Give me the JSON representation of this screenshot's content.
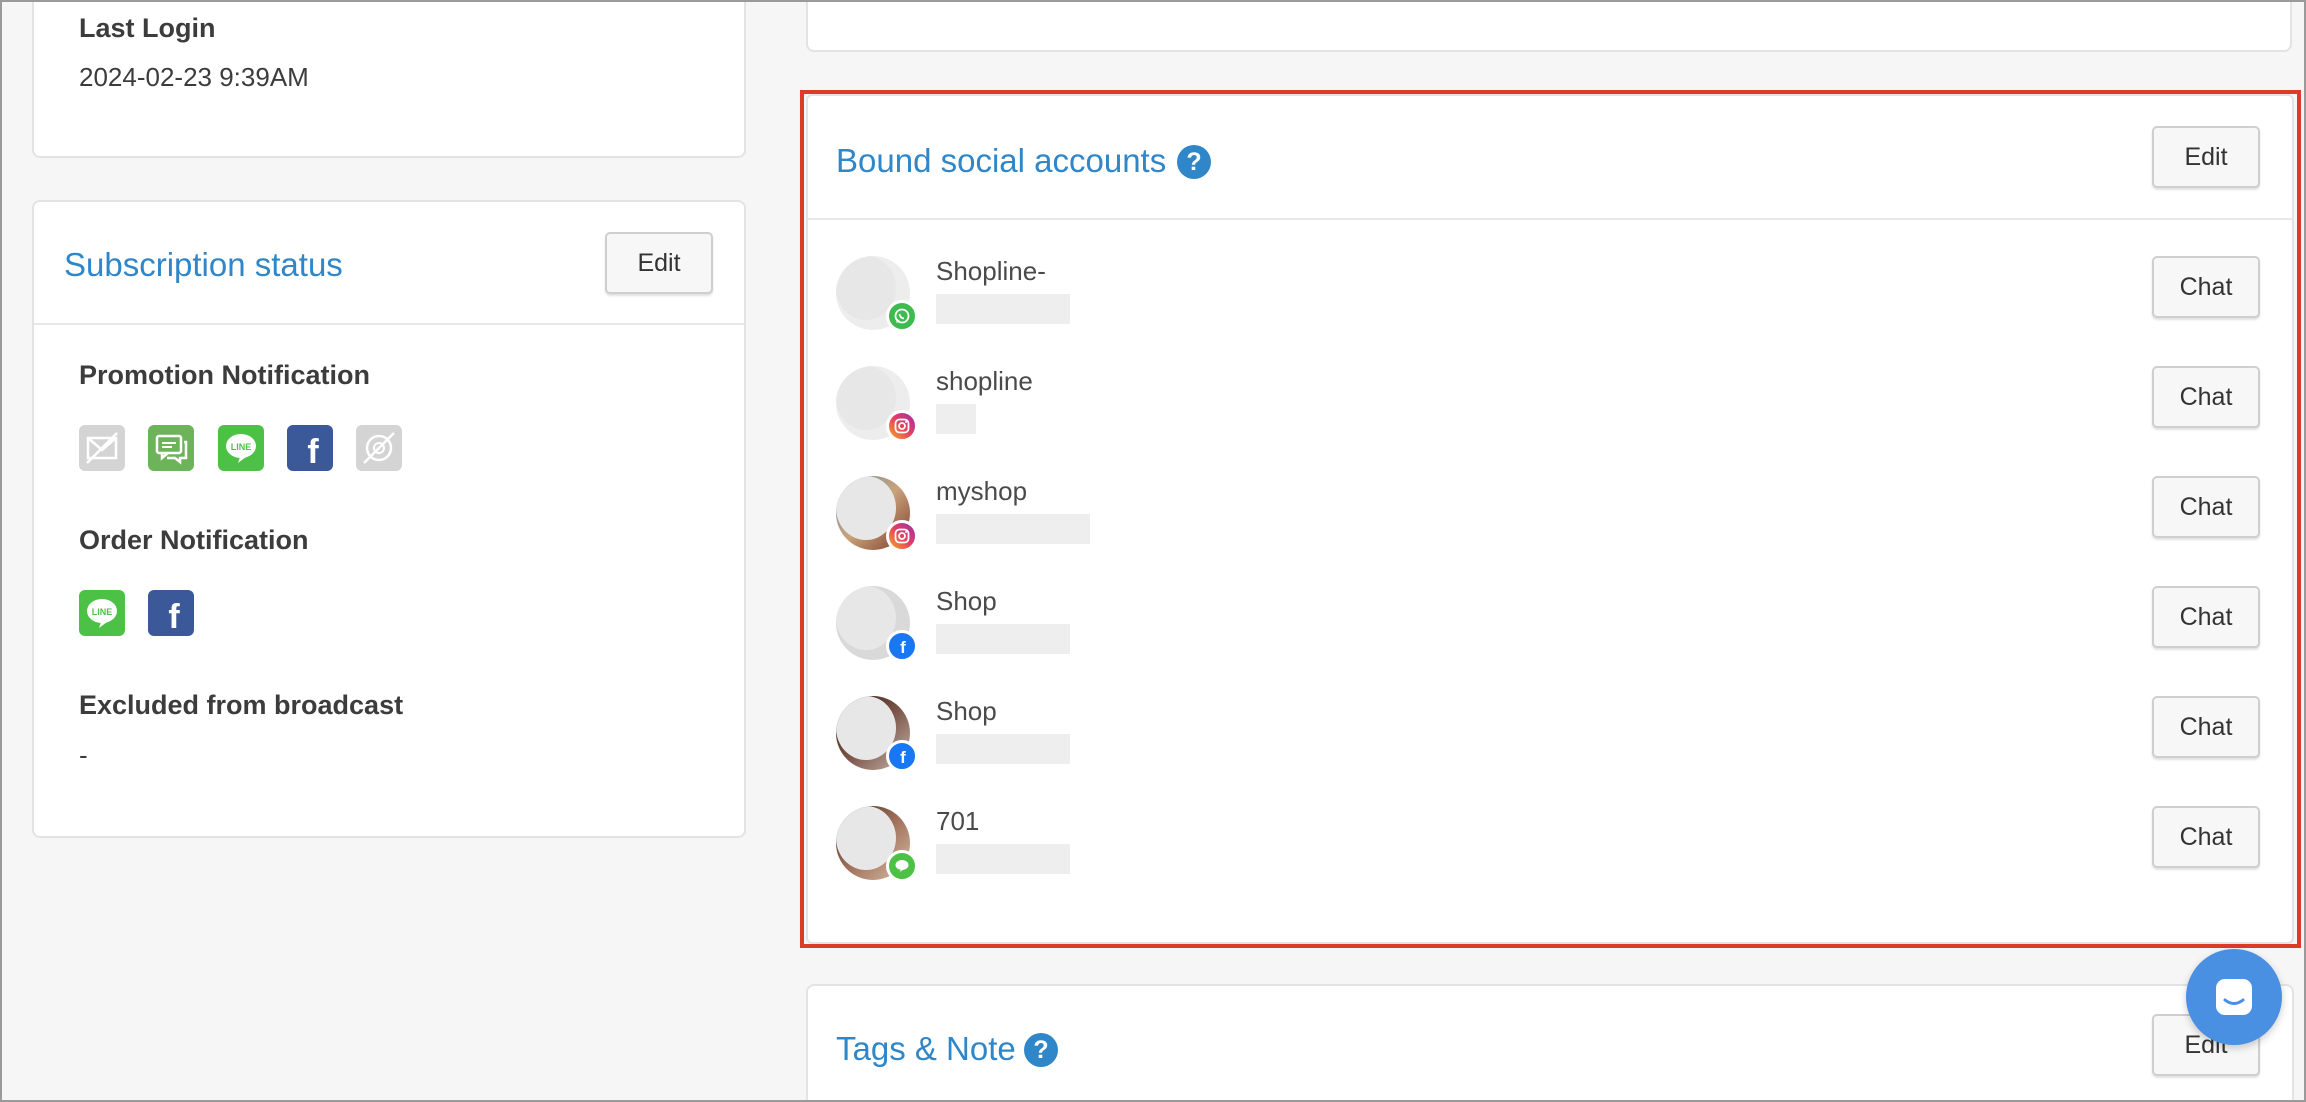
{
  "login": {
    "label": "Last Login",
    "value": "2024-02-23 9:39AM"
  },
  "subscription": {
    "title": "Subscription status",
    "edit_label": "Edit",
    "promotion_label": "Promotion Notification",
    "promotion_channels": [
      {
        "name": "email",
        "icon": "email-disabled-icon",
        "enabled": false
      },
      {
        "name": "sms",
        "icon": "sms-icon",
        "enabled": true
      },
      {
        "name": "line",
        "icon": "line-icon",
        "enabled": true
      },
      {
        "name": "facebook",
        "icon": "facebook-icon",
        "enabled": true
      },
      {
        "name": "other",
        "icon": "disabled-channel-icon",
        "enabled": false
      }
    ],
    "order_label": "Order Notification",
    "order_channels": [
      {
        "name": "line",
        "icon": "line-icon",
        "enabled": true
      },
      {
        "name": "facebook",
        "icon": "facebook-icon",
        "enabled": true
      }
    ],
    "excluded_label": "Excluded from broadcast",
    "excluded_value": "-"
  },
  "bound_accounts": {
    "title": "Bound social accounts",
    "edit_label": "Edit",
    "accounts": [
      {
        "name": "Shopline-",
        "platform": "whatsapp",
        "chat_label": "Chat"
      },
      {
        "name": "shopline",
        "platform": "instagram",
        "chat_label": "Chat"
      },
      {
        "name": "myshop",
        "platform": "instagram",
        "chat_label": "Chat"
      },
      {
        "name": "Shop",
        "platform": "facebook",
        "chat_label": "Chat"
      },
      {
        "name": "Shop",
        "platform": "facebook",
        "chat_label": "Chat"
      },
      {
        "name": "701",
        "platform": "line",
        "chat_label": "Chat"
      }
    ]
  },
  "tags_note": {
    "title": "Tags & Note",
    "edit_label": "Edit"
  },
  "colors": {
    "accent": "#2f86c8",
    "highlight": "#dc3b26",
    "line_green": "#4cc145",
    "facebook_blue": "#3b5998",
    "sms_green": "#6db35a",
    "fab_blue": "#4a90e2"
  }
}
